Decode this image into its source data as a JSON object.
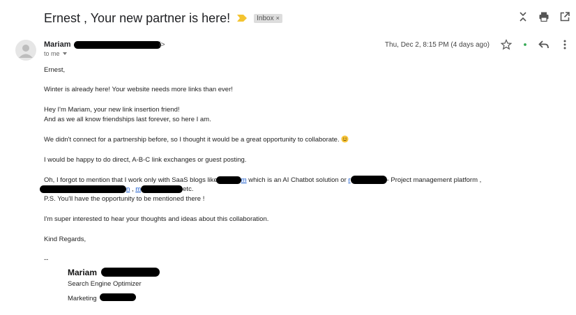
{
  "email": {
    "subject": "Ernest , Your new partner is here!",
    "label": "Inbox",
    "label_remove": "×",
    "sender_name": "Mariam",
    "sender_email_tail": "i>",
    "recipient": "to me",
    "date": "Thu, Dec 2, 8:15 PM (4 days ago)"
  },
  "body": {
    "greeting": "Ernest,",
    "p1": "Winter is already here! Your website needs more links than ever!",
    "p2a": "Hey I'm Mariam, your new link insertion friend!",
    "p2b": "And as we all know friendships last forever, so here I am.",
    "p3": "We didn't connect for a partnership before, so I thought it would be a great opportunity to collaborate.",
    "p4": "I would be happy to do direct, A-B-C link exchanges or guest posting.",
    "p5_pre": "Oh, I forgot to mention that I work only with SaaS blogs like",
    "p5_link1_tail": "m",
    "p5_mid": "which is an AI Chatbot solution or",
    "p5_link2_head": "r",
    "p5_post": "- Project management platform ,",
    "p5_link3_tail": "n",
    "p5_sep": ",",
    "p5_link4_head": "m",
    "p5_end": "etc.",
    "p6": "P.S. You'll have the opportunity to be mentioned there !",
    "p7": "I'm super interested to hear your thoughts and ideas about this collaboration.",
    "closing": "Kind Regards,",
    "sig_sep": "--"
  },
  "signature": {
    "name": "Mariam",
    "title": "Search Engine Optimizer",
    "company_prefix": "Marketing"
  },
  "icons": [
    "importance-marker-icon",
    "expand-all-icon",
    "print-icon",
    "open-new-window-icon",
    "avatar-icon",
    "dropdown-caret-icon",
    "star-icon",
    "status-dot-icon",
    "reply-icon",
    "more-options-icon",
    "smiley-emoji-icon"
  ],
  "colors": {
    "link": "#1155cc",
    "status_dot": "#34a853",
    "importance": "#f4c430",
    "redaction": "#000000"
  }
}
